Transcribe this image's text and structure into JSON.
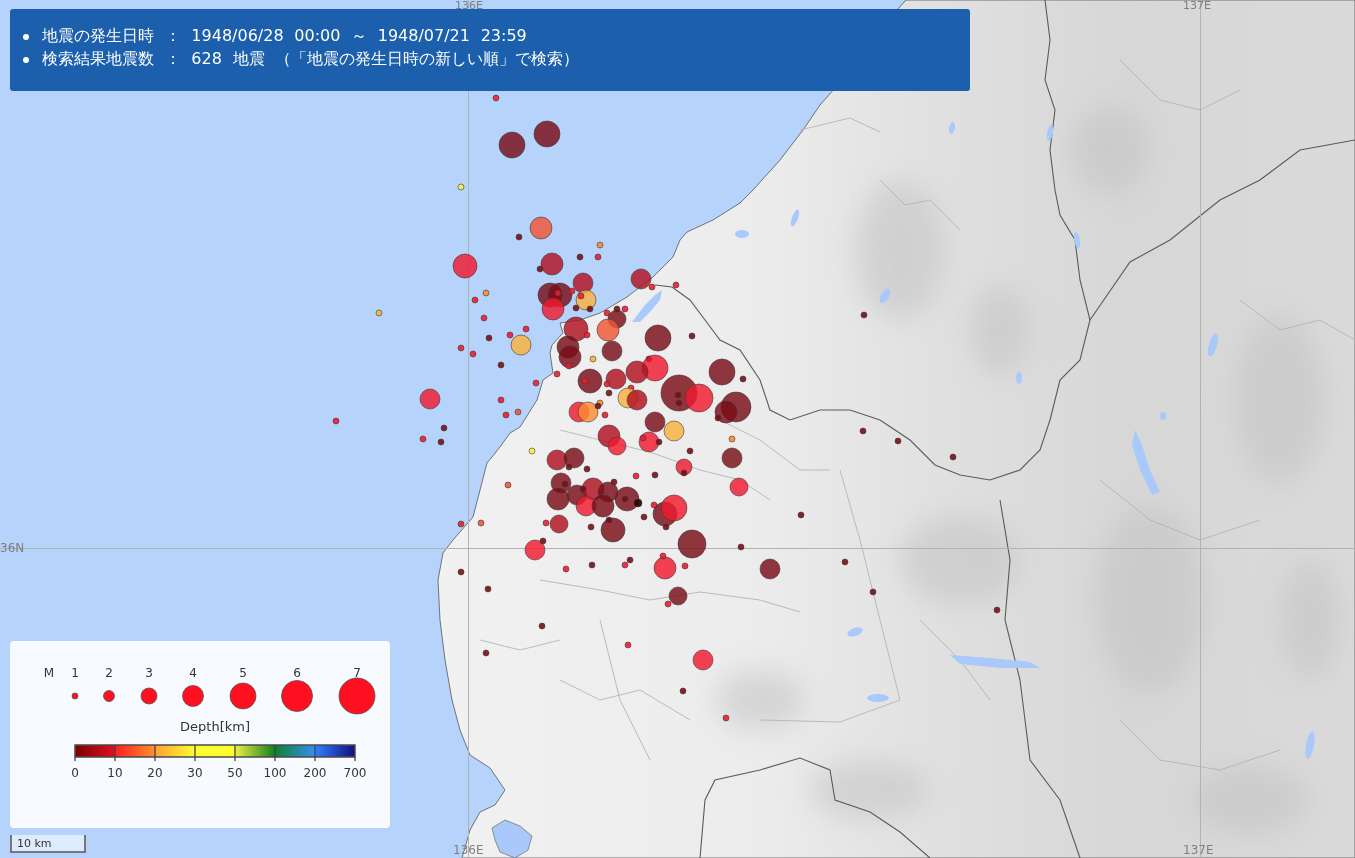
{
  "header": {
    "lines": [
      "地震の発生日時 ： 1948/06/28 00:00 ～ 1948/07/21 23:59",
      "検索結果地震数 ： 628 地震 （「地震の発生日時の新しい順」で検索）"
    ]
  },
  "grid_labels": {
    "top": [
      "136E",
      "137E"
    ],
    "left": [
      "36N"
    ],
    "bottom": [
      "136E",
      "137E"
    ]
  },
  "legend": {
    "magnitude_title": "M",
    "magnitudes": [
      "1",
      "2",
      "3",
      "4",
      "5",
      "6",
      "7"
    ],
    "depth_title": "Depth[km]",
    "depth_ticks": [
      "0",
      "10",
      "20",
      "30",
      "50",
      "100",
      "200",
      "700"
    ]
  },
  "scale_bar": {
    "label": "10 km"
  }
}
